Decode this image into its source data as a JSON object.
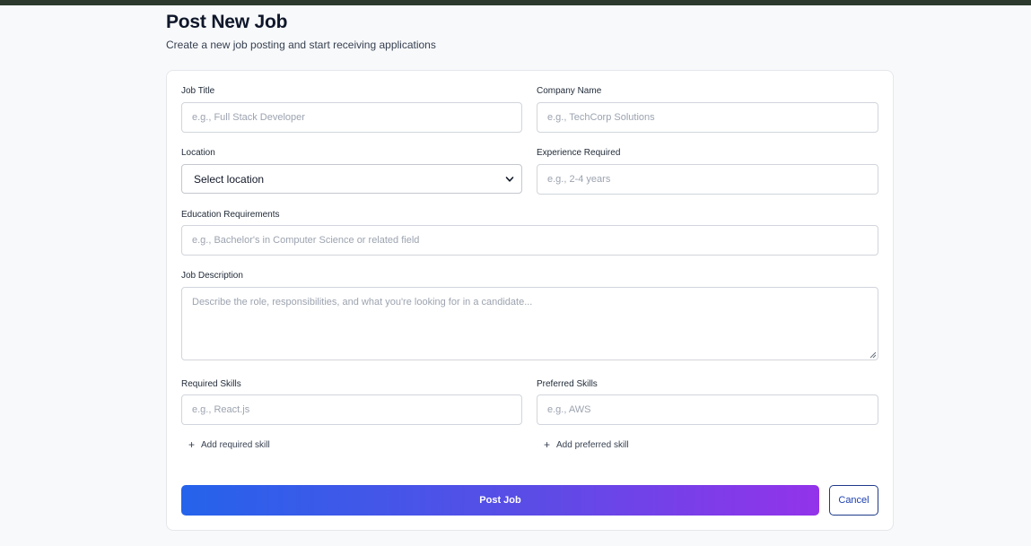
{
  "header": {
    "title": "Post New Job",
    "subtitle": "Create a new job posting and start receiving applications"
  },
  "form": {
    "job_title": {
      "label": "Job Title",
      "placeholder": "e.g., Full Stack Developer",
      "value": ""
    },
    "company_name": {
      "label": "Company Name",
      "placeholder": "e.g., TechCorp Solutions",
      "value": ""
    },
    "location": {
      "label": "Location",
      "selected": "Select location"
    },
    "experience": {
      "label": "Experience Required",
      "placeholder": "e.g., 2-4 years",
      "value": ""
    },
    "education": {
      "label": "Education Requirements",
      "placeholder": "e.g., Bachelor's in Computer Science or related field",
      "value": ""
    },
    "description": {
      "label": "Job Description",
      "placeholder": "Describe the role, responsibilities, and what you're looking for in a candidate...",
      "value": ""
    },
    "required_skills": {
      "label": "Required Skills",
      "placeholder": "e.g., React.js",
      "add_label": "Add required skill"
    },
    "preferred_skills": {
      "label": "Preferred Skills",
      "placeholder": "e.g., AWS",
      "add_label": "Add preferred skill"
    }
  },
  "actions": {
    "post_label": "Post Job",
    "cancel_label": "Cancel"
  },
  "icons": {
    "add": "plus-icon",
    "dropdown": "chevron-down-icon"
  },
  "colors": {
    "gradient_start": "#2563eb",
    "gradient_end": "#9333ea",
    "cancel_border": "#1e3a8a"
  }
}
